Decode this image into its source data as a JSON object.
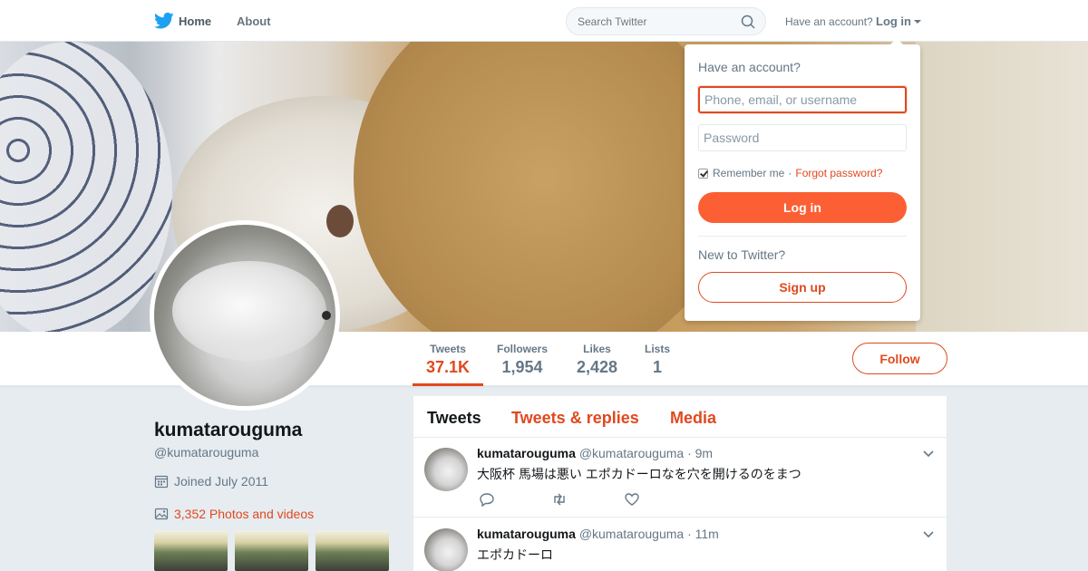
{
  "nav": {
    "home_label": "Home",
    "about_label": "About",
    "search_placeholder": "Search Twitter",
    "have_account": "Have an account?",
    "login_label": "Log in"
  },
  "profile": {
    "display_name": "kumatarouguma",
    "screen_name": "@kumatarouguma",
    "joined": "Joined July 2011",
    "photos_label": "3,352 Photos and videos",
    "follow_label": "Follow"
  },
  "stats": [
    {
      "label": "Tweets",
      "value": "37.1K"
    },
    {
      "label": "Followers",
      "value": "1,954"
    },
    {
      "label": "Likes",
      "value": "2,428"
    },
    {
      "label": "Lists",
      "value": "1"
    }
  ],
  "timeline": {
    "tabs": [
      "Tweets",
      "Tweets & replies",
      "Media"
    ],
    "tweets": [
      {
        "name": "kumatarouguma",
        "handle": "@kumatarouguma",
        "time": "· 9m",
        "text": "大阪杯 馬場は悪い エポカドーロなを穴を開けるのをまつ"
      },
      {
        "name": "kumatarouguma",
        "handle": "@kumatarouguma",
        "time": "· 11m",
        "text": "エポカドーロ"
      }
    ]
  },
  "login_dropdown": {
    "title": "Have an account?",
    "username_placeholder": "Phone, email, or username",
    "password_placeholder": "Password",
    "remember_label": "Remember me",
    "separator": "·",
    "forgot_label": "Forgot password?",
    "login_button": "Log in",
    "new_label": "New to Twitter?",
    "signup_button": "Sign up"
  },
  "colors": {
    "accent": "#e0491f",
    "login_button": "#fc5f33",
    "twitter_blue": "#1da1f2"
  }
}
